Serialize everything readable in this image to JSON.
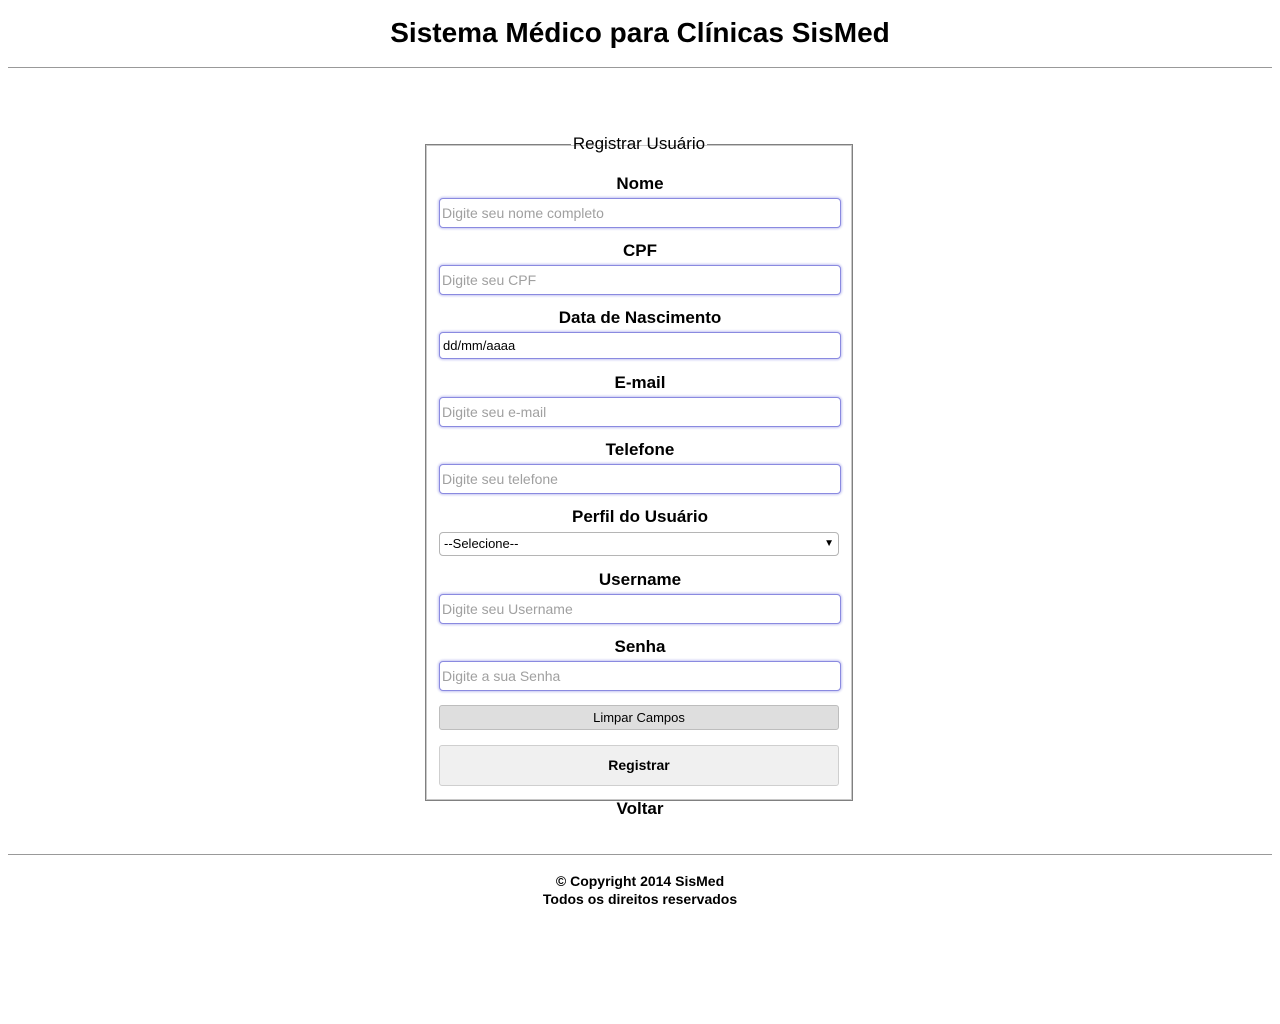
{
  "header": {
    "title": "Sistema Médico para Clínicas SisMed"
  },
  "form": {
    "legend": "Registrar Usuário",
    "fields": {
      "nome": {
        "label": "Nome",
        "placeholder": "Digite seu nome completo"
      },
      "cpf": {
        "label": "CPF",
        "placeholder": "Digite seu CPF"
      },
      "nascimento": {
        "label": "Data de Nascimento",
        "value": "dd/mm/aaaa"
      },
      "email": {
        "label": "E-mail",
        "placeholder": "Digite seu e-mail"
      },
      "telefone": {
        "label": "Telefone",
        "placeholder": "Digite seu telefone"
      },
      "perfil": {
        "label": "Perfil do Usuário",
        "selected": "--Selecione--"
      },
      "username": {
        "label": "Username",
        "placeholder": "Digite seu Username"
      },
      "senha": {
        "label": "Senha",
        "placeholder": "Digite a sua Senha"
      }
    },
    "clear_label": "Limpar Campos",
    "register_label": "Registrar",
    "back_label": "Voltar"
  },
  "footer": {
    "copyright": "© Copyright 2014 SisMed",
    "rights": "Todos os direitos reservados"
  },
  "icons": {
    "select_chevron": "chevron-down-icon"
  }
}
